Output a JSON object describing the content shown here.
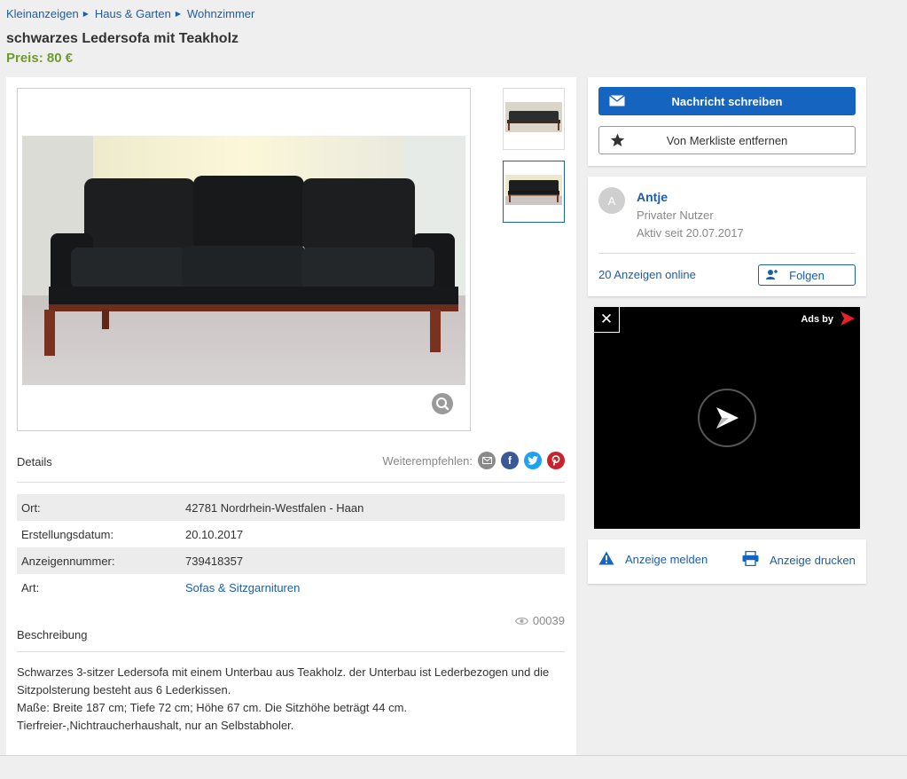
{
  "breadcrumb": [
    "Kleinanzeigen",
    "Haus & Garten",
    "Wohnzimmer"
  ],
  "listing": {
    "title": "schwarzes Ledersofa mit Teakholz",
    "price": "Preis: 80 €"
  },
  "details": {
    "heading": "Details",
    "share_label": "Weiterempfehlen:",
    "share_icons": [
      "email-icon",
      "facebook-icon",
      "twitter-icon",
      "pinterest-icon"
    ],
    "rows": [
      {
        "key": "Ort:",
        "value": "42781 Nordrhein-Westfalen - Haan"
      },
      {
        "key": "Erstellungsdatum:",
        "value": "20.10.2017"
      },
      {
        "key": "Anzeigennummer:",
        "value": "739418357"
      },
      {
        "key": "Art:",
        "value": "Sofas & Sitzgarnituren"
      }
    ]
  },
  "views": "00039",
  "description": {
    "heading": "Beschreibung",
    "lines": [
      "Schwarzes 3-sitzer Ledersofa mit einem Unterbau aus Teakholz. der Unterbau ist Lederbezogen und die",
      "Sitzpolsterung besteht aus 6 Lederkissen.",
      "Maße: Breite 187 cm; Tiefe 72 cm; Höhe 67 cm. Die Sitzhöhe beträgt 44 cm.",
      "Tierfreier-,Nichtraucherhaushalt, nur an Selbstabholer."
    ]
  },
  "actions": {
    "message": "Nachricht schreiben",
    "watchlist": "Von Merkliste entfernen"
  },
  "seller": {
    "initial": "A",
    "name": "Antje",
    "type": "Privater Nutzer",
    "since": "Aktiv seit 20.07.2017",
    "ads_online": "20 Anzeigen online",
    "follow": "Folgen"
  },
  "ad": {
    "close": "✕",
    "ads_by": "Ads by"
  },
  "links": {
    "report": "Anzeige melden",
    "print": "Anzeige drucken"
  },
  "colors": {
    "accent": "#1565c0",
    "link": "#1d5ea8",
    "price": "#6e9c2d"
  }
}
